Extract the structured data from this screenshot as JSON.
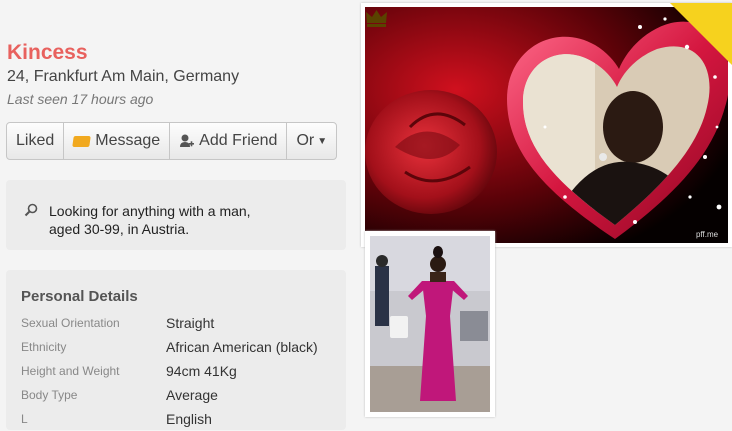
{
  "profile": {
    "name": "Kincess",
    "location": "24, Frankfurt Am Main, Germany",
    "last_seen": "Last seen 17 hours ago"
  },
  "actions": {
    "liked": "Liked",
    "message": "Message",
    "add_friend": "Add Friend",
    "or": "Or"
  },
  "looking_for": {
    "line1": "Looking for anything with a man,",
    "line2": "aged 30-99, in Austria.",
    "icon": "search-icon"
  },
  "personal_details": {
    "title": "Personal Details",
    "rows": [
      {
        "label": "Sexual Orientation",
        "value": "Straight"
      },
      {
        "label": "Ethnicity",
        "value": "African American (black)"
      },
      {
        "label": "Height and Weight",
        "value": "94cm 41Kg"
      },
      {
        "label": "Body Type",
        "value": "Average"
      },
      {
        "label": "L",
        "value": "English"
      }
    ]
  },
  "photos": {
    "watermark": "pff.me",
    "badge_icon": "crown-icon"
  },
  "colors": {
    "name_accent": "#e8615e",
    "message_icon": "#f1a91f",
    "badge": "#f6d21e"
  }
}
